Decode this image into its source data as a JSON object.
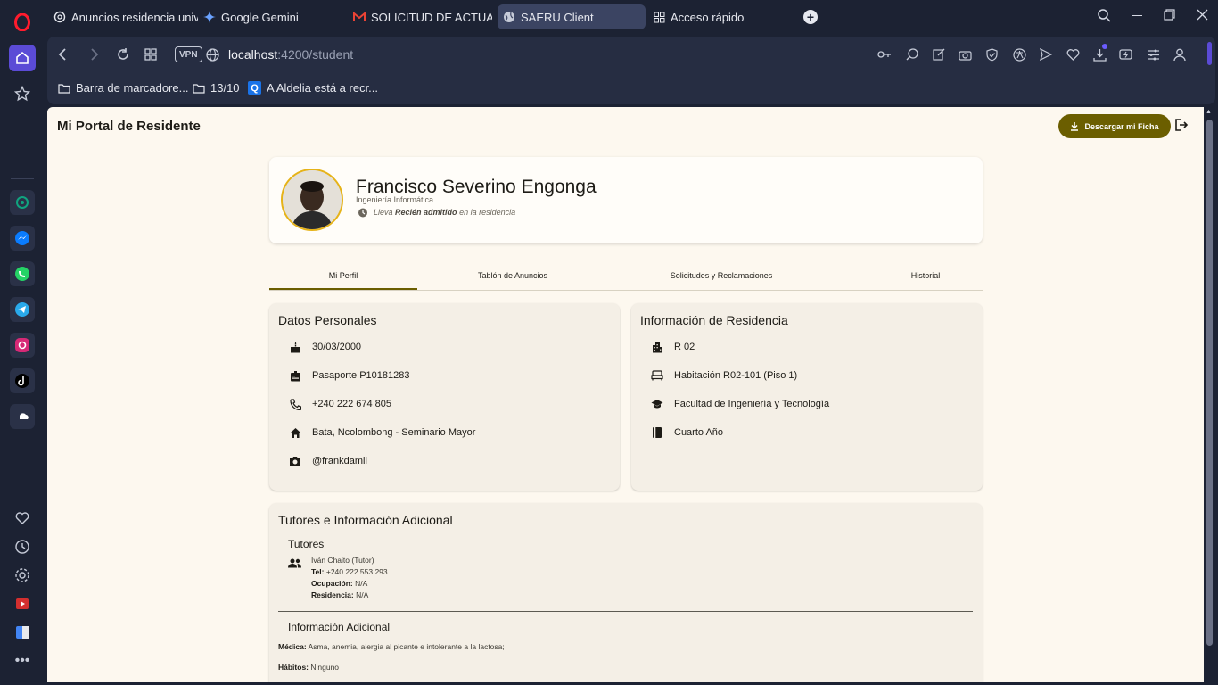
{
  "browser": {
    "tabs": [
      {
        "label": "Anuncios residencia unive",
        "icon": "openai-icon"
      },
      {
        "label": "Google Gemini",
        "icon": "gemini-icon"
      },
      {
        "label": "SOLICITUD DE ACTUALIZA",
        "icon": "gmail-icon"
      },
      {
        "label": "SAERU Client",
        "icon": "globe-icon"
      },
      {
        "label": "Acceso rápido",
        "icon": "grid-icon"
      }
    ],
    "url_host": "localhost",
    "url_path": ":4200/student",
    "vpn_label": "VPN",
    "bookmarks": [
      {
        "label": "Barra de marcadore..."
      },
      {
        "label": "13/10"
      },
      {
        "label": "A Aldelia está a recr..."
      }
    ]
  },
  "app": {
    "title": "Mi Portal de Residente",
    "download_label": "Descargar mi Ficha",
    "accent_color": "#6b5e00"
  },
  "profile": {
    "name": "Francisco Severino Engonga",
    "career": "Ingeniería Informática",
    "status_prefix": "Lleva",
    "status_value": "Recién admitido",
    "status_suffix": "en la residencia"
  },
  "nav_tabs": [
    {
      "label": "Mi Perfil"
    },
    {
      "label": "Tablón de Anuncios"
    },
    {
      "label": "Solicitudes y Reclamaciones"
    },
    {
      "label": "Historial"
    }
  ],
  "personal": {
    "title": "Datos Personales",
    "birthdate": "30/03/2000",
    "document": "Pasaporte P10181283",
    "phone": "+240 222 674 805",
    "address": "Bata, Ncolombong - Seminario Mayor",
    "instagram": "@frankdamii"
  },
  "residence": {
    "title": "Información de Residencia",
    "building": "R 02",
    "room": "Habitación R02-101 (Piso 1)",
    "faculty": "Facultad de Ingeniería y Tecnología",
    "year": "Cuarto Año"
  },
  "tutors": {
    "title": "Tutores e Información Adicional",
    "subtitle": "Tutores",
    "name": "Iván Chaito (Tutor)",
    "tel_label": "Tel:",
    "tel": "+240 222 553 293",
    "job_label": "Ocupación:",
    "job": "N/A",
    "res_label": "Residencia:",
    "res": "N/A",
    "extra_title": "Información Adicional",
    "medical_label": "Médica:",
    "medical": "Asma, anemia, alergia al picante e intolerante a la lactosa;",
    "habits_label": "Hábitos:",
    "habits": "Ninguno"
  }
}
